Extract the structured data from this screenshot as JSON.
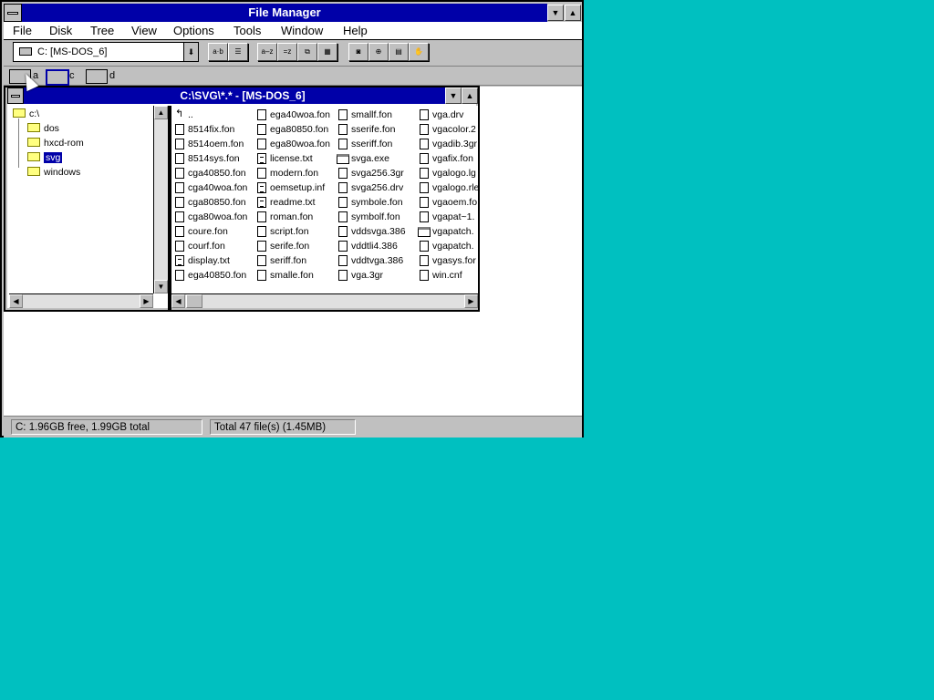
{
  "app": {
    "title": "File Manager"
  },
  "menu": [
    {
      "label": "File"
    },
    {
      "label": "Disk"
    },
    {
      "label": "Tree"
    },
    {
      "label": "View"
    },
    {
      "label": "Options"
    },
    {
      "label": "Tools"
    },
    {
      "label": "Window"
    },
    {
      "label": "Help"
    }
  ],
  "toolbar": {
    "drive_selector": "C: [MS-DOS_6]"
  },
  "drives": [
    {
      "letter": "a"
    },
    {
      "letter": "c"
    },
    {
      "letter": "d"
    }
  ],
  "child_window": {
    "title": "C:\\SVG\\*.* - [MS-DOS_6]",
    "tree": [
      {
        "label": "c:\\"
      },
      {
        "label": "dos"
      },
      {
        "label": "hxcd-rom"
      },
      {
        "label": "svg"
      },
      {
        "label": "windows"
      }
    ],
    "files": {
      "col1": [
        "..",
        "8514fix.fon",
        "8514oem.fon",
        "8514sys.fon",
        "cga40850.fon",
        "cga40woa.fon",
        "cga80850.fon",
        "cga80woa.fon",
        "coure.fon",
        "courf.fon",
        "display.txt",
        "ega40850.fon"
      ],
      "col2": [
        "ega40woa.fon",
        "ega80850.fon",
        "ega80woa.fon",
        "license.txt",
        "modern.fon",
        "oemsetup.inf",
        "readme.txt",
        "roman.fon",
        "script.fon",
        "serife.fon",
        "seriff.fon",
        "smalle.fon"
      ],
      "col3": [
        "smallf.fon",
        "sserife.fon",
        "sseriff.fon",
        "svga.exe",
        "svga256.3gr",
        "svga256.drv",
        "symbole.fon",
        "symbolf.fon",
        "vddsvga.386",
        "vddtli4.386",
        "vddtvga.386",
        "vga.3gr"
      ],
      "col4": [
        "vga.drv",
        "vgacolor.2",
        "vgadib.3gr",
        "vgafix.fon",
        "vgalogo.lg",
        "vgalogo.rle",
        "vgaoem.fo",
        "vgapat~1.",
        "vgapatch.",
        "vgapatch.",
        "vgasys.for",
        "win.cnf"
      ]
    }
  },
  "status": {
    "disk": "C: 1.96GB free,  1.99GB total",
    "total": "Total 47 file(s) (1.45MB)"
  }
}
